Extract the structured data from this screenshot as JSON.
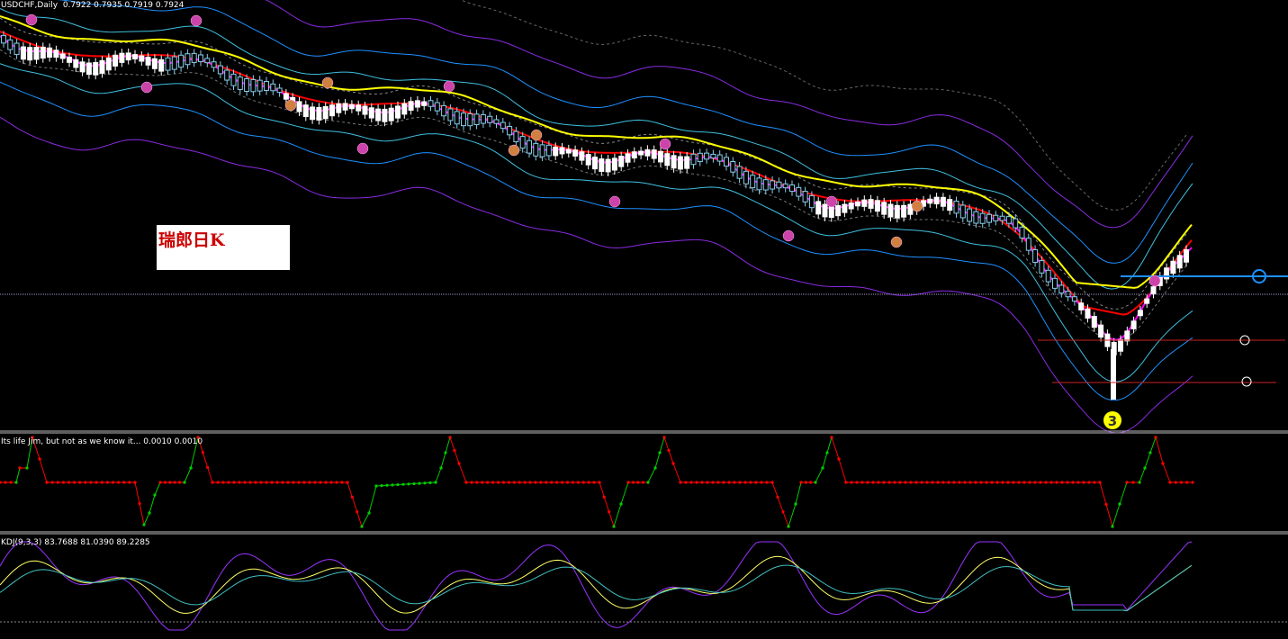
{
  "header": {
    "symbol": "USDCHF,Daily",
    "ohlc": "0.7922 0.7935 0.7919 0.7924"
  },
  "note": {
    "text": "瑞郎日K"
  },
  "wave_marker": {
    "label": "3"
  },
  "indicators": {
    "zigzag_label": "Its life Jim, but not as we know it...  0.0010 0.0010",
    "kdj_label": "KDJ(9,3,3) 83.7688 81.0390 89.2285"
  },
  "colors": {
    "background": "#000000",
    "bull_candle": "#87ceeb",
    "bear_candle": "#ffffff",
    "ma_yellow": "#ffff00",
    "ma_red": "#ff0000",
    "ma_magenta": "#ff00ff",
    "band_violet": "#8a2be2",
    "band_blue": "#1e90ff",
    "band_cyan": "#40c0e0",
    "level_blue": "#1e90ff",
    "level_red": "#cc2222",
    "zigzag_up": "#00cc00",
    "zigzag_down": "#ff0000",
    "kdj_k": "#ffff66",
    "kdj_d": "#40c0c0",
    "kdj_j": "#9933ff"
  },
  "chart_data": {
    "type": "candlestick",
    "symbol": "USDCHF",
    "timeframe": "Daily",
    "last": {
      "open": 0.7922,
      "high": 0.7935,
      "low": 0.7919,
      "close": 0.7924
    },
    "trend": "down",
    "indicators": [
      "KDJ(9,3,3)"
    ],
    "kdj_last": {
      "K": 83.7688,
      "D": 81.039,
      "J": 89.2285
    }
  }
}
